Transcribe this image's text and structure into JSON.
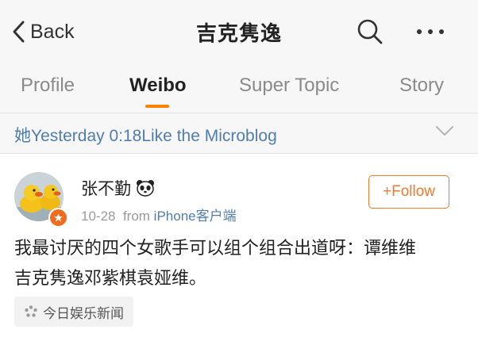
{
  "header": {
    "back_label": "Back",
    "title": "吉克隽逸",
    "icons": [
      "chevron-left-icon",
      "search-icon",
      "more-icon"
    ]
  },
  "tabs": [
    {
      "label": "Profile",
      "active": false
    },
    {
      "label": "Weibo",
      "active": true
    },
    {
      "label": "Super Topic",
      "active": false
    },
    {
      "label": "Story",
      "active": false
    }
  ],
  "notice": {
    "text": "她Yesterday 0:18Like the Microblog"
  },
  "post": {
    "username": "张不勤",
    "date": "10-28",
    "from_prefix": "from",
    "source": "iPhone客户端",
    "follow_label": "+Follow",
    "text_line1": "我最讨厌的四个女歌手可以组个组合出道呀：谭维维",
    "text_line2": "吉克隽逸邓紫棋袁娅维。",
    "topic_tag": "今日娱乐新闻"
  },
  "colors": {
    "accent": "#ff8200",
    "link": "#507daf",
    "follow": "#f07a2b",
    "badge": "#f26b1d"
  }
}
